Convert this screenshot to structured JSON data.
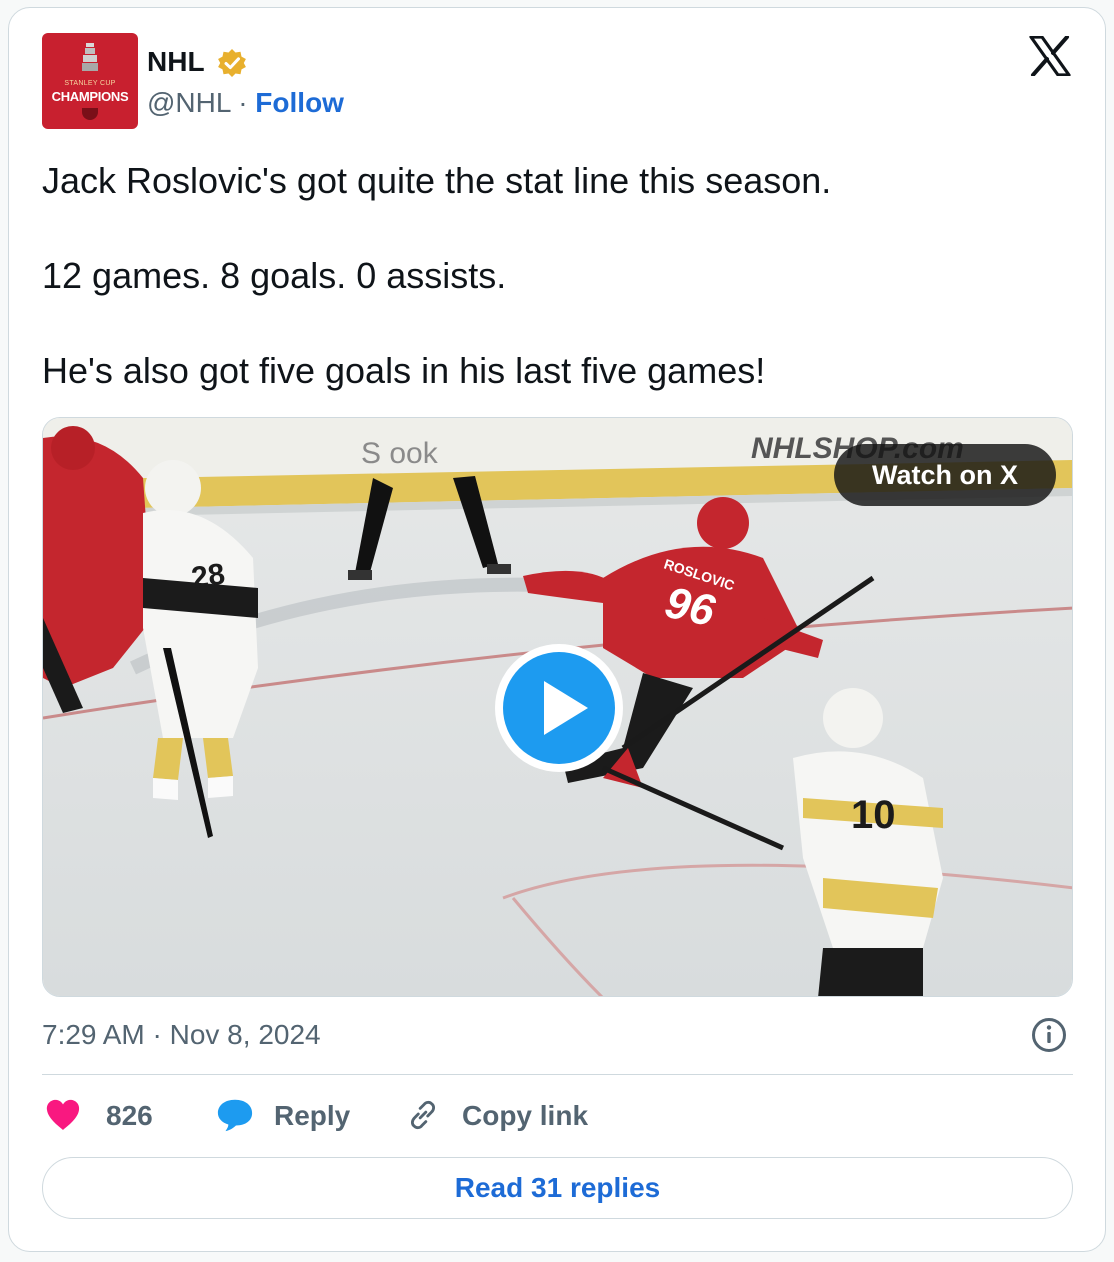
{
  "account": {
    "name": "NHL",
    "handle": "@NHL",
    "separator": "·",
    "follow_label": "Follow",
    "avatar_text_top": "STANLEY CUP",
    "avatar_text_main": "CHAMPIONS",
    "verified_color": "#e8b02e"
  },
  "tweet": {
    "lines": [
      "Jack Roslovic's got quite the stat line this season.",
      "12 games. 8 goals. 0 assists.",
      "He's also got five goals in his last five games!"
    ]
  },
  "media": {
    "watch_label": "Watch on X",
    "icon": "play-icon",
    "scene_text": {
      "board_left": "S      ook",
      "board_right": "NHLSHOP.com",
      "jersey_red_name": "ROSLOVIC",
      "jersey_red_number": "96",
      "jersey_white_number_left": "28",
      "jersey_white_number_right": "10"
    }
  },
  "meta": {
    "timestamp": "7:29 AM · Nov 8, 2024"
  },
  "actions": {
    "likes": "826",
    "reply_label": "Reply",
    "copy_label": "Copy link"
  },
  "footer": {
    "read_replies_label": "Read 31 replies"
  },
  "colors": {
    "link": "#1d6bd6",
    "like": "#f91880",
    "reply_icon": "#1d9bf0",
    "play_button": "#1d9bf0",
    "avatar_bg": "#c8202f"
  }
}
